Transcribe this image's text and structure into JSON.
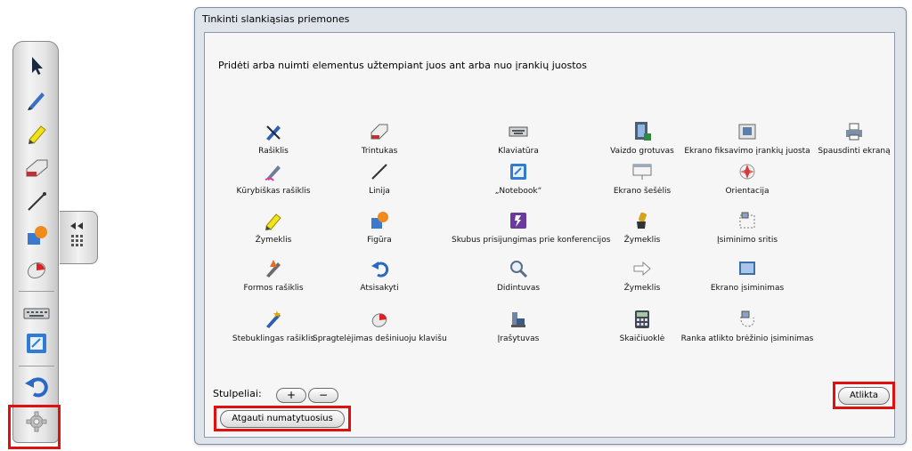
{
  "dialog": {
    "title": "Tinkinti slankiąsias priemones",
    "instruction": "Pridėti arba nuimti elementus užtempiant juos ant arba nuo įrankių juostos",
    "tools": [
      {
        "label": "Rašiklis",
        "icon": "pen-icon"
      },
      {
        "label": "Trintukas",
        "icon": "eraser-icon"
      },
      {
        "label": "Klaviatūra",
        "icon": "keyboard-icon"
      },
      {
        "label": "Vaizdo grotuvas",
        "icon": "video-player-icon"
      },
      {
        "label": "Ekrano fiksavimo įrankių juosta",
        "icon": "screen-capture-icon"
      },
      {
        "label": "Spausdinti ekraną",
        "icon": "printer-icon"
      },
      {
        "label": "Kūrybiškas rašiklis",
        "icon": "creative-pen-icon"
      },
      {
        "label": "Linija",
        "icon": "line-icon"
      },
      {
        "label": "„Notebook“",
        "icon": "notebook-icon"
      },
      {
        "label": "Ekrano šešėlis",
        "icon": "screen-shade-icon"
      },
      {
        "label": "Orientacija",
        "icon": "orientation-icon"
      },
      {
        "label": "Žymeklis",
        "icon": "highlighter-icon"
      },
      {
        "label": "Figūra",
        "icon": "shape-icon"
      },
      {
        "label": "Skubus prisijungimas prie konferencijos",
        "icon": "conference-icon"
      },
      {
        "label": "Žymeklis",
        "icon": "pointer-icon"
      },
      {
        "label": "Įsiminimo sritis",
        "icon": "area-capture-icon"
      },
      {
        "label": "Formos rašiklis",
        "icon": "shape-pen-icon"
      },
      {
        "label": "Atsisakyti",
        "icon": "undo-icon"
      },
      {
        "label": "Didintuvas",
        "icon": "magnifier-icon"
      },
      {
        "label": "Žymeklis",
        "icon": "arrow-pointer-icon"
      },
      {
        "label": "Ekrano įsiminimas",
        "icon": "screen-capture-full-icon"
      },
      {
        "label": "Stebuklingas rašiklis",
        "icon": "magic-pen-icon"
      },
      {
        "label": "Spragtelėjimas dešiniuoju klavišu",
        "icon": "right-click-icon"
      },
      {
        "label": "Įrašytuvas",
        "icon": "recorder-icon"
      },
      {
        "label": "Skaičiuoklė",
        "icon": "calculator-icon"
      },
      {
        "label": "Ranka atlikto brėžinio įsiminimas",
        "icon": "freehand-capture-icon"
      }
    ],
    "columns_label": "Stulpeliai:",
    "plus_label": "+",
    "minus_label": "−",
    "restore_label": "Atgauti numatytuosius",
    "done_label": "Atlikta"
  },
  "toolbar": {
    "items": [
      "select-arrow-icon",
      "pen-icon",
      "highlighter-icon",
      "eraser-icon",
      "line-icon",
      "shape-icon",
      "right-click-icon",
      "keyboard-icon",
      "notebook-icon",
      "undo-icon",
      "settings-gear-icon"
    ]
  },
  "colors": {
    "highlight": "#e01010",
    "accent_blue": "#3a7bd5"
  }
}
